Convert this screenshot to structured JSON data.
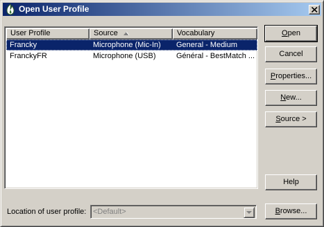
{
  "window": {
    "title": "Open User Profile",
    "icon": "dragon-flame-icon",
    "close_icon": "close-icon"
  },
  "list": {
    "columns": [
      {
        "label": "User Profile"
      },
      {
        "label": "Source",
        "sort": "ascending"
      },
      {
        "label": "Vocabulary"
      }
    ],
    "rows": [
      {
        "profile": "Francky",
        "source": "Microphone (Mic-In)",
        "vocabulary": "General - Medium",
        "selected": true
      },
      {
        "profile": "FranckyFR",
        "source": "Microphone (USB)",
        "vocabulary": "Général - BestMatch ...",
        "selected": false
      }
    ]
  },
  "buttons": {
    "open": {
      "label": "Open",
      "hotkey": "O",
      "rest": "pen"
    },
    "cancel": {
      "label": "Cancel"
    },
    "properties": {
      "label": "Properties...",
      "hotkey": "P",
      "rest": "roperties..."
    },
    "new": {
      "label": "New...",
      "hotkey": "N",
      "rest": "ew..."
    },
    "source": {
      "label": "Source >",
      "hotkey": "S",
      "rest": "ource >"
    },
    "help": {
      "label": "Help"
    },
    "browse": {
      "label": "Browse...",
      "hotkey": "B",
      "rest": "rowse..."
    }
  },
  "location": {
    "label": "Location of user profile:",
    "value": "<Default>"
  },
  "colors": {
    "title_bar": "#0a246a",
    "selection": "#0a246a",
    "face": "#d4d0c8"
  }
}
